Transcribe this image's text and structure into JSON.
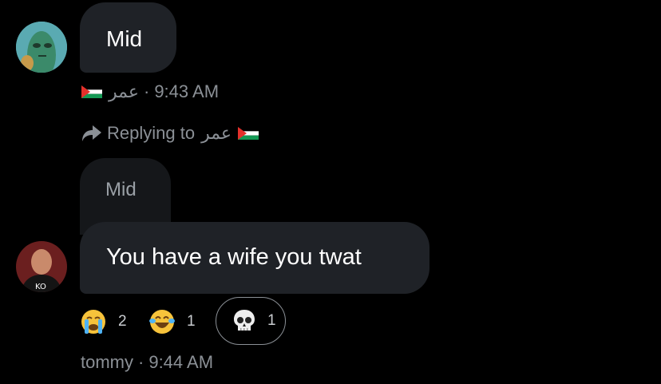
{
  "messages": [
    {
      "text": "Mid",
      "sender": "عمر",
      "time": "9:43 AM",
      "separator": "·",
      "sender_flag": "palestine-flag-icon"
    },
    {
      "reply": {
        "prefix": "Replying to",
        "to": "عمر",
        "icon": "reply-arrow-icon",
        "flag": "palestine-flag-icon",
        "quoted_text": "Mid"
      },
      "text": "You have a wife you twat",
      "reactions": [
        {
          "emoji": "loudly-crying-face-icon",
          "count": "2",
          "selected": false
        },
        {
          "emoji": "face-with-tears-of-joy-icon",
          "count": "1",
          "selected": false
        },
        {
          "emoji": "skull-icon",
          "count": "1",
          "selected": true
        }
      ],
      "sender": "tommy",
      "separator": "·",
      "time": "9:44 AM"
    }
  ],
  "colors": {
    "background": "#000000",
    "bubble": "#1f2227",
    "meta_text": "#8b9096",
    "quoted_text": "#9aa0a6"
  }
}
